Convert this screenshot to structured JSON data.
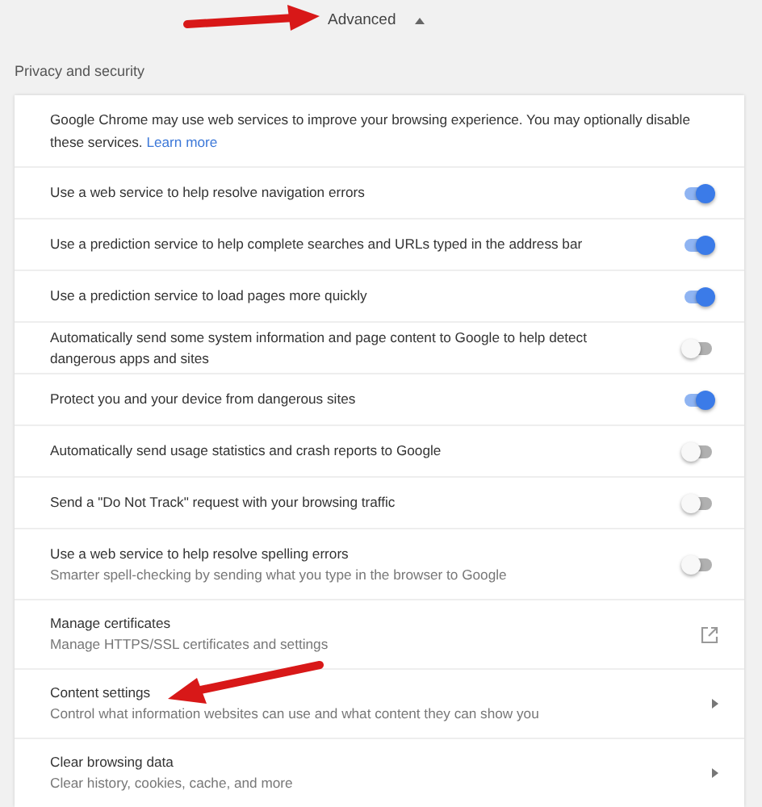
{
  "advanced": {
    "label": "Advanced",
    "expanded": true
  },
  "section_title": "Privacy and security",
  "intro": {
    "text": "Google Chrome may use web services to improve your browsing experience. You may optionally disable these services.",
    "link": "Learn more"
  },
  "settings": [
    {
      "kind": "toggle",
      "label": "Use a web service to help resolve navigation errors",
      "on": true
    },
    {
      "kind": "toggle",
      "label": "Use a prediction service to help complete searches and URLs typed in the address bar",
      "on": true
    },
    {
      "kind": "toggle",
      "label": "Use a prediction service to load pages more quickly",
      "on": true
    },
    {
      "kind": "toggle",
      "label": "Automatically send some system information and page content to Google to help detect dangerous apps and sites",
      "on": false
    },
    {
      "kind": "toggle",
      "label": "Protect you and your device from dangerous sites",
      "on": true
    },
    {
      "kind": "toggle",
      "label": "Automatically send usage statistics and crash reports to Google",
      "on": false
    },
    {
      "kind": "toggle",
      "label": "Send a \"Do Not Track\" request with your browsing traffic",
      "on": false
    },
    {
      "kind": "toggle",
      "label": "Use a web service to help resolve spelling errors",
      "description": "Smarter spell-checking by sending what you type in the browser to Google",
      "on": false
    },
    {
      "kind": "external",
      "label": "Manage certificates",
      "description": "Manage HTTPS/SSL certificates and settings"
    },
    {
      "kind": "submenu",
      "label": "Content settings",
      "description": "Control what information websites can use and what content they can show you"
    },
    {
      "kind": "submenu",
      "label": "Clear browsing data",
      "description": "Clear history, cookies, cache, and more"
    }
  ]
}
